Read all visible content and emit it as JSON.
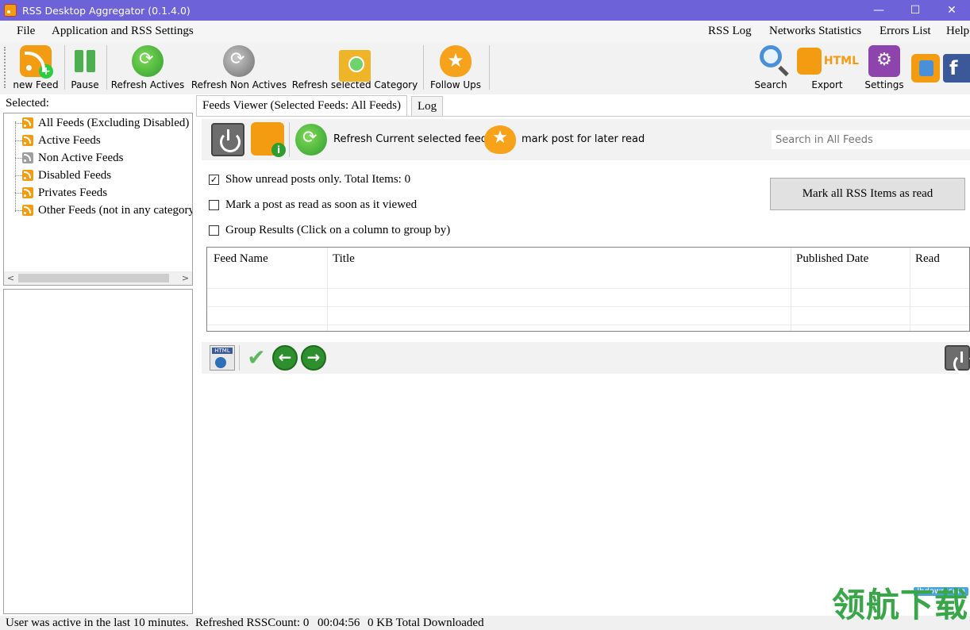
{
  "window": {
    "title": "RSS Desktop Aggregator (0.1.4.0)",
    "minimize": "—",
    "maximize": "☐",
    "close": "✕"
  },
  "menu": {
    "file": "File",
    "settings": "Application and RSS Settings",
    "rss_log": "RSS Log",
    "network_stats": "Networks Statistics",
    "errors": "Errors List",
    "help": "Help"
  },
  "toolbar": {
    "new_feed": "new Feed",
    "pause": "Pause",
    "refresh_actives": "Refresh Actives",
    "refresh_non_actives": "Refresh Non Actives",
    "refresh_category": "Refresh selected Category",
    "follow_ups": "Follow Ups",
    "search": "Search",
    "export": "Export",
    "export_html": "HTML",
    "settings": "Settings"
  },
  "left": {
    "selected_label": "Selected:",
    "tree": [
      {
        "label": "All Feeds (Excluding Disabled)",
        "color": "#f39c12"
      },
      {
        "label": "Active Feeds",
        "color": "#f39c12"
      },
      {
        "label": "Non Active Feeds",
        "color": "#9e9e9e"
      },
      {
        "label": "Disabled Feeds",
        "color": "#f39c12"
      },
      {
        "label": "Privates Feeds",
        "color": "#f39c12"
      },
      {
        "label": "Other Feeds (not in any category)",
        "color": "#f39c12"
      }
    ],
    "scroll_left": "<",
    "scroll_right": ">"
  },
  "tabs": {
    "feeds_viewer": "Feeds Viewer (Selected Feeds: All Feeds)",
    "log": "Log"
  },
  "viewer": {
    "refresh_current": "Refresh Current selected feeds",
    "mark_later": "mark post for later read",
    "search_placeholder": "Search in All Feeds",
    "show_unread": "Show unread posts only. Total Items: 0",
    "show_unread_checked": true,
    "mark_viewed": "Mark a post as read as soon as it viewed",
    "group_results": "Group Results (Click on a column to group by)",
    "mark_all_button": "Mark all RSS Items as read",
    "columns": [
      "Feed Name",
      "Title",
      "Published Date",
      "Read"
    ]
  },
  "bottom_toolbar": {
    "html_label": "HTML",
    "check": "✔",
    "prev": "←",
    "next": "→"
  },
  "status": {
    "activity": "User was active in the last 10 minutes.",
    "refreshed": "Refreshed RSSCount: 0",
    "time": "00:04:56",
    "downloaded": "0 KB Total Downloaded"
  },
  "watermark": {
    "text": "领航下载",
    "url": "lhdown.com"
  },
  "colors": {
    "titlebar": "#6e62d8",
    "rss_orange": "#f39c12",
    "green": "#2e9e2e"
  }
}
